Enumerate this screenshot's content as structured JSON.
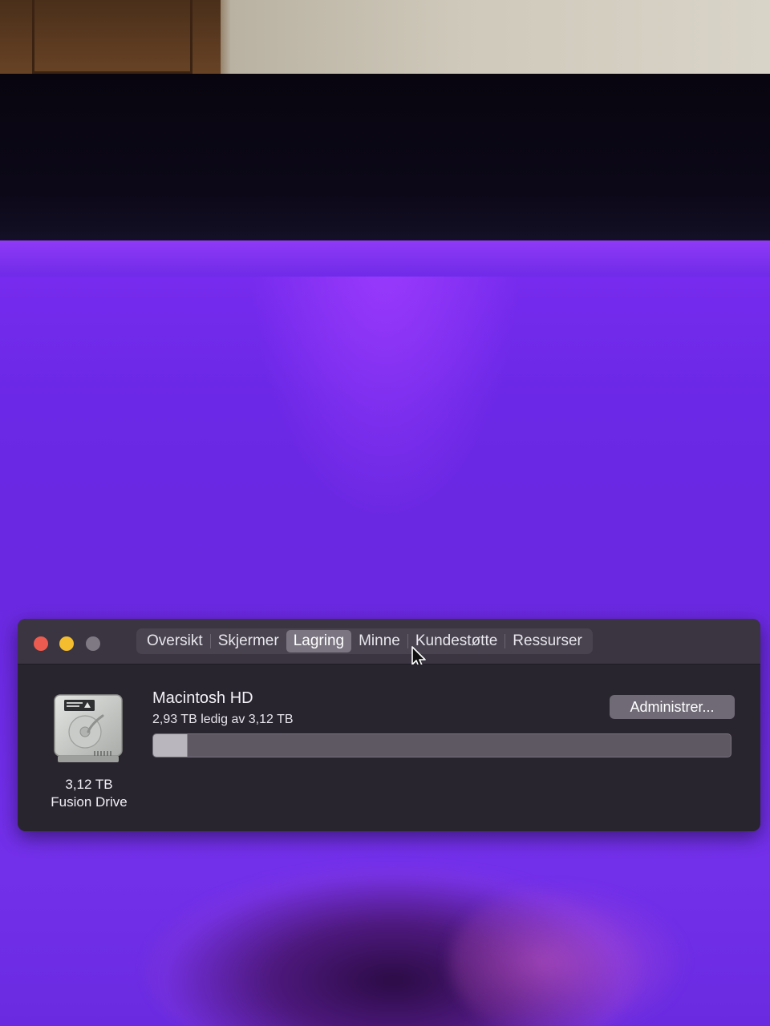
{
  "window": {
    "tabs": [
      {
        "label": "Oversikt",
        "active": false
      },
      {
        "label": "Skjermer",
        "active": false
      },
      {
        "label": "Lagring",
        "active": true
      },
      {
        "label": "Minne",
        "active": false
      },
      {
        "label": "Kundestøtte",
        "active": false
      },
      {
        "label": "Ressurser",
        "active": false
      }
    ],
    "traffic_lights": {
      "close_color": "#ec5b50",
      "minimize_color": "#f3bd2f",
      "zoom_color": "#7e7983"
    }
  },
  "storage": {
    "disk_icon": "hard-drive-icon",
    "disk_size": "3,12 TB",
    "disk_kind": "Fusion Drive",
    "volume_name": "Macintosh HD",
    "free_text": "2,93 TB ledig av 3,12 TB",
    "used_fraction": 0.06,
    "manage_label": "Administrer..."
  }
}
